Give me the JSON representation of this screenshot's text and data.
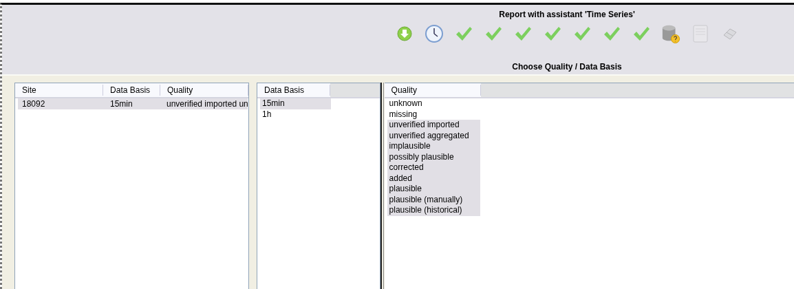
{
  "header": {
    "title": "Report with assistant 'Time Series'",
    "subtitle": "Choose Quality / Data Basis",
    "toolbar": [
      {
        "kind": "download",
        "disabled": false
      },
      {
        "kind": "clock",
        "disabled": false
      },
      {
        "kind": "check",
        "disabled": false
      },
      {
        "kind": "check",
        "disabled": false
      },
      {
        "kind": "check",
        "disabled": false
      },
      {
        "kind": "check",
        "disabled": false
      },
      {
        "kind": "check",
        "disabled": false
      },
      {
        "kind": "check",
        "disabled": false
      },
      {
        "kind": "check",
        "disabled": false
      },
      {
        "kind": "database",
        "disabled": false
      },
      {
        "kind": "document",
        "disabled": true
      },
      {
        "kind": "eraser",
        "disabled": true
      }
    ]
  },
  "sites_table": {
    "columns": [
      "Site",
      "Data Basis",
      "Quality"
    ],
    "rows": [
      {
        "cells": [
          "18092",
          "15min",
          "unverified imported un"
        ],
        "selected": true
      }
    ]
  },
  "data_basis_list": {
    "column": "Data Basis",
    "items": [
      {
        "label": "15min",
        "selected": true
      },
      {
        "label": "1h",
        "selected": false
      }
    ]
  },
  "quality_list": {
    "column": "Quality",
    "items": [
      {
        "label": "unknown",
        "selected": false
      },
      {
        "label": "missing",
        "selected": false
      },
      {
        "label": "unverified imported",
        "selected": true
      },
      {
        "label": "unverified aggregated",
        "selected": true
      },
      {
        "label": "implausible",
        "selected": true
      },
      {
        "label": "possibly plausible",
        "selected": true
      },
      {
        "label": "corrected",
        "selected": true
      },
      {
        "label": "added",
        "selected": true
      },
      {
        "label": "plausible",
        "selected": true
      },
      {
        "label": "plausible (manually)",
        "selected": true
      },
      {
        "label": "plausible (historical)",
        "selected": true
      }
    ]
  }
}
